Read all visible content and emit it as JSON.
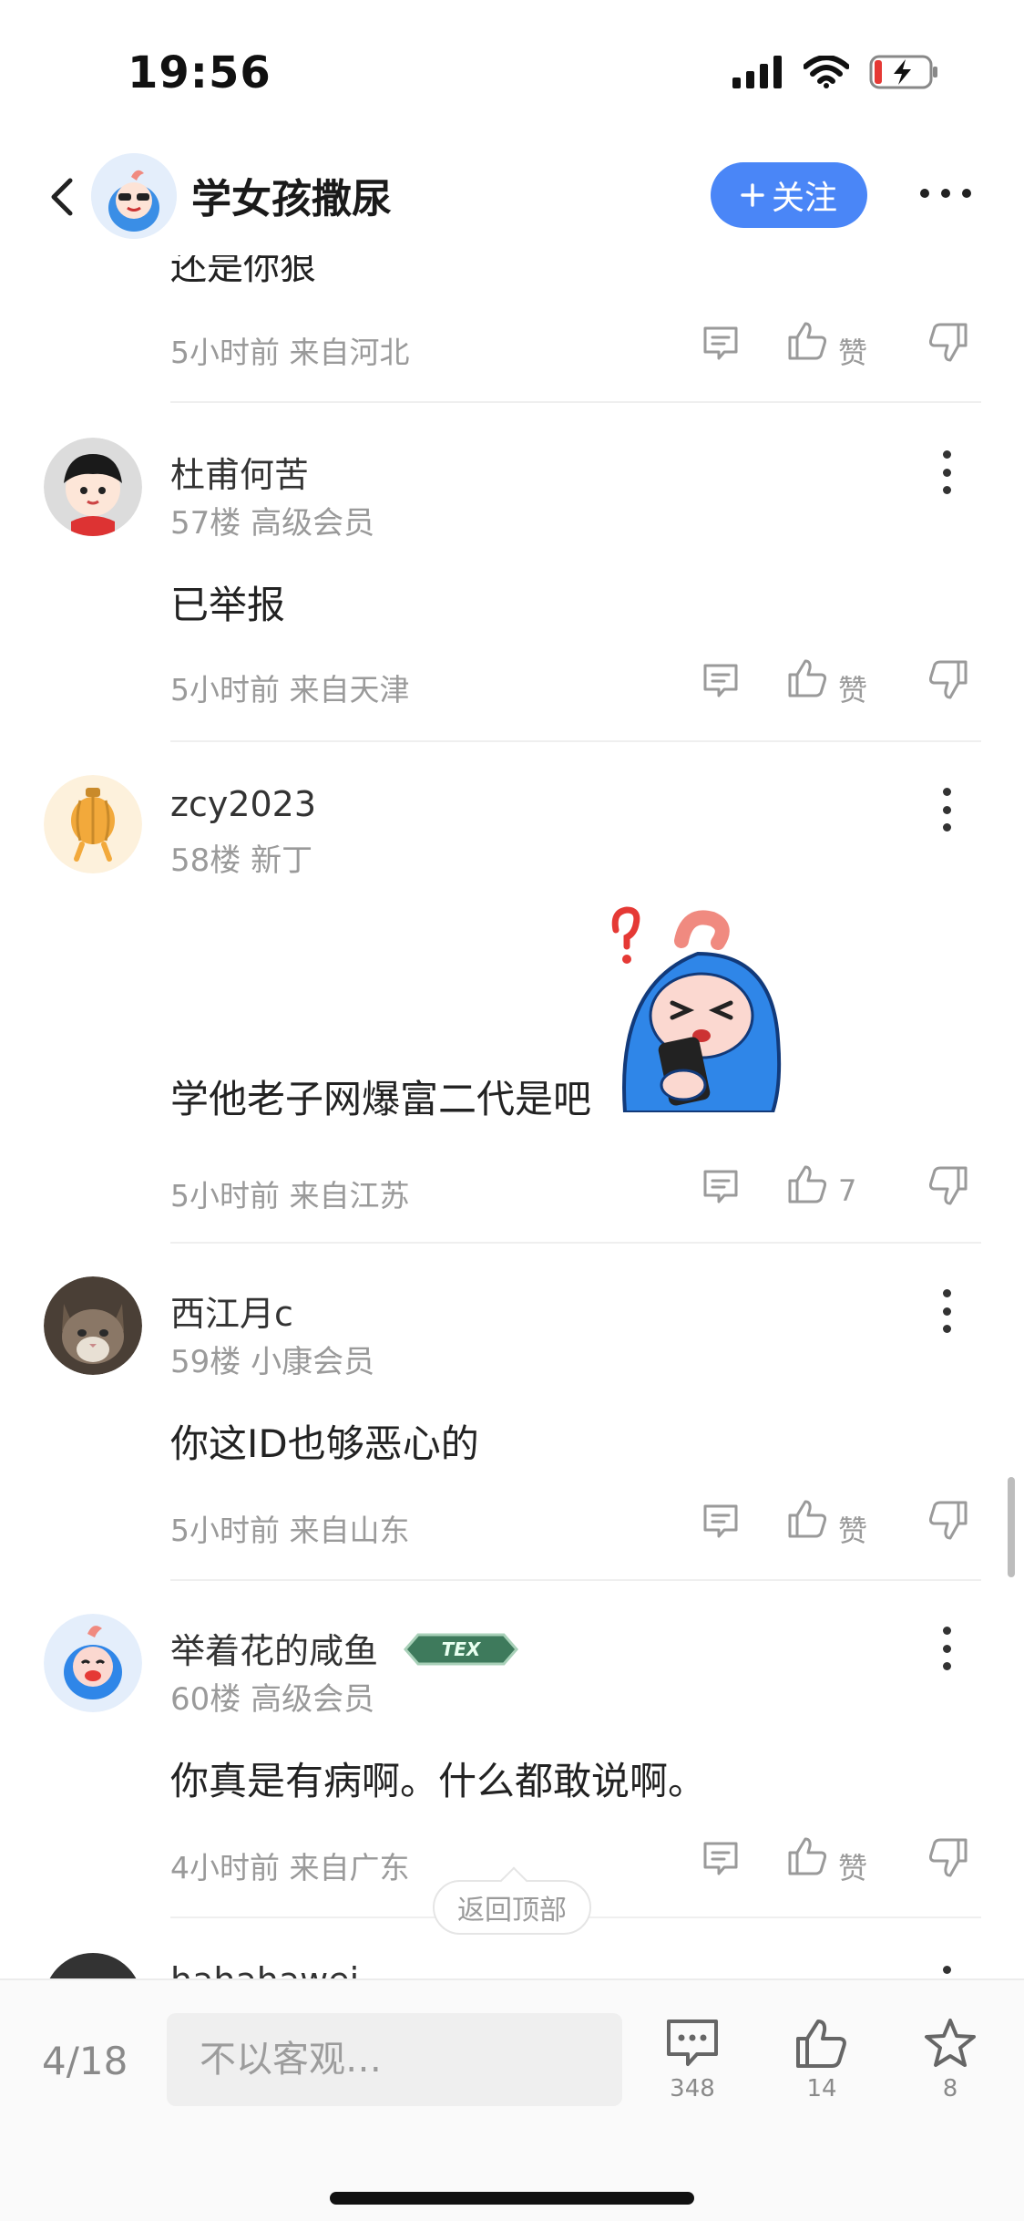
{
  "status": {
    "time": "19:56"
  },
  "header": {
    "title": "学女孩撒尿",
    "follow_label": "关注"
  },
  "partial_comment": {
    "text": "还是你狠",
    "time": "5小时前",
    "location": "来自河北",
    "like_label": "赞"
  },
  "comments": [
    {
      "name": "杜甫何苦",
      "floor": "57楼",
      "level": "高级会员",
      "body": "已举报",
      "time": "5小时前",
      "location": "来自天津",
      "like_label": "赞"
    },
    {
      "name": "zcy2023",
      "floor": "58楼",
      "level": "新丁",
      "body": "学他老子网爆富二代是吧",
      "time": "5小时前",
      "location": "来自江苏",
      "like_label": "7"
    },
    {
      "name": "西江月c",
      "floor": "59楼",
      "level": "小康会员",
      "body": "你这ID也够恶心的",
      "time": "5小时前",
      "location": "来自山东",
      "like_label": "赞"
    },
    {
      "name": "举着花的咸鱼",
      "floor": "60楼",
      "level": "高级会员",
      "body": "你真是有病啊。什么都敢说啊。",
      "time": "4小时前",
      "location": "来自广东",
      "like_label": "赞",
      "badge_text": "TEX"
    },
    {
      "name": "hahahawei"
    }
  ],
  "back_to_top": "返回顶部",
  "bottom_bar": {
    "page_indicator": "4/18",
    "input_placeholder": "不以客观…",
    "comment_count": "348",
    "like_count": "14",
    "star_count": "8"
  },
  "colors": {
    "accent": "#4a86f7",
    "meta_gray": "#9a9a9a"
  }
}
